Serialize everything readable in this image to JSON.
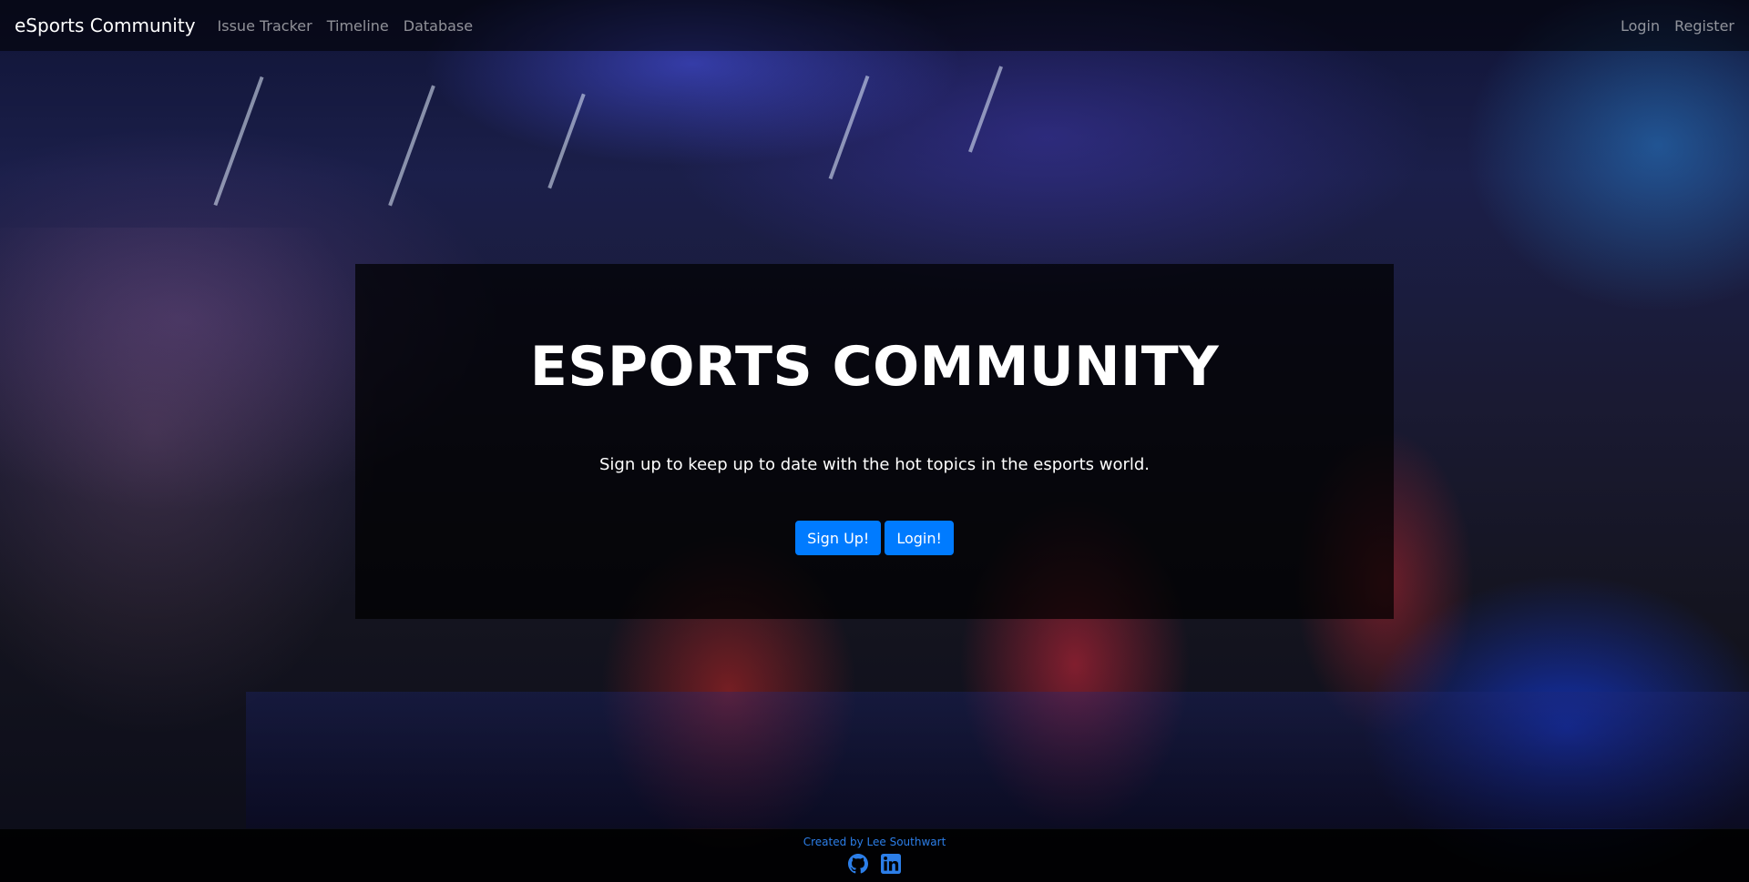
{
  "navbar": {
    "brand": "eSports Community",
    "links": [
      "Issue Tracker",
      "Timeline",
      "Database"
    ],
    "right_links": [
      "Login",
      "Register"
    ]
  },
  "hero": {
    "title": "ESPORTS COMMUNITY",
    "subtitle": "Sign up to keep up to date with the hot topics in the esports world.",
    "buttons": {
      "signup": "Sign Up!",
      "login": "Login!"
    }
  },
  "footer": {
    "credit": "Created by Lee Southwart",
    "icons": [
      "github-icon",
      "linkedin-icon"
    ]
  },
  "colors": {
    "primary": "#007bff",
    "footer_link": "#2c7ee8"
  }
}
